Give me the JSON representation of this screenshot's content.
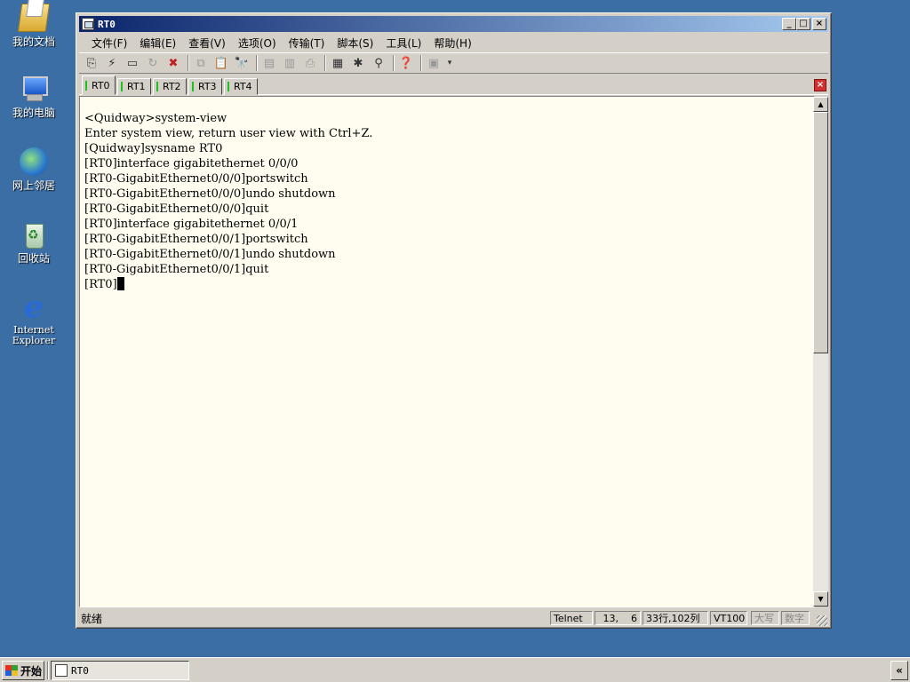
{
  "desktop": {
    "icons": [
      {
        "label": "我的文档",
        "icon": "my-documents-icon"
      },
      {
        "label": "我的电脑",
        "icon": "my-computer-icon"
      },
      {
        "label": "网上邻居",
        "icon": "network-places-icon"
      },
      {
        "label": "回收站",
        "icon": "recycle-bin-icon"
      },
      {
        "label": "Internet Explorer",
        "icon": "internet-explorer-icon"
      }
    ]
  },
  "window": {
    "title": "RT0",
    "minimize": "_",
    "maximize": "□",
    "close": "×"
  },
  "menu": {
    "items": [
      "文件(F)",
      "编辑(E)",
      "查看(V)",
      "选项(O)",
      "传输(T)",
      "脚本(S)",
      "工具(L)",
      "帮助(H)"
    ]
  },
  "tabs": {
    "items": [
      "RT0",
      "RT1",
      "RT2",
      "RT3",
      "RT4"
    ],
    "active": "RT0",
    "accent": "#20c020",
    "close": "×"
  },
  "terminal": {
    "lines": [
      "<Quidway>system-view",
      "Enter system view, return user view with Ctrl+Z.",
      "[Quidway]sysname RT0",
      "[RT0]interface gigabitethernet 0/0/0",
      "[RT0-GigabitEthernet0/0/0]portswitch",
      "[RT0-GigabitEthernet0/0/0]undo shutdown",
      "[RT0-GigabitEthernet0/0/0]quit",
      "[RT0]interface gigabitethernet 0/0/1",
      "[RT0-GigabitEthernet0/0/1]portswitch",
      "[RT0-GigabitEthernet0/0/1]undo shutdown",
      "[RT0-GigabitEthernet0/0/1]quit"
    ],
    "prompt": "[RT0]",
    "background": "#fffcf0"
  },
  "status": {
    "ready": "就绪",
    "protocol": "Telnet",
    "row": "13,",
    "col": "6",
    "size": "33行,102列",
    "emulation": "VT100",
    "caps": "大写",
    "num": "数字"
  },
  "taskbar": {
    "start": "开始",
    "task": "RT0",
    "tray_toggle": "«"
  }
}
